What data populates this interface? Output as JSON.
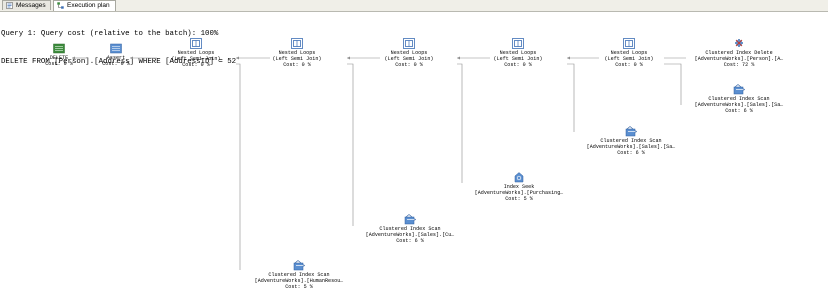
{
  "tabs": [
    {
      "label": "Messages",
      "icon": "messages-icon",
      "active": false
    },
    {
      "label": "Execution plan",
      "icon": "execution-plan-icon",
      "active": true
    }
  ],
  "query": {
    "header": "Query 1: Query cost (relative to the batch): 100%",
    "statement": "DELETE FROM [Person].[Address] WHERE [AddressID] = 52"
  },
  "colors": {
    "icon_blue": "#3d6fb5",
    "icon_green": "#3c8a3c",
    "line": "#8c8c8c"
  },
  "plan": {
    "nodes": [
      {
        "id": "delete",
        "icon": "delete-result-icon",
        "lines": [
          "DELETE",
          "Cost: 0 %"
        ]
      },
      {
        "id": "assert",
        "icon": "assert-icon",
        "lines": [
          "Assert",
          "Cost: 0 %"
        ]
      },
      {
        "id": "nl1",
        "icon": "nested-loops-icon",
        "lines": [
          "Nested Loops",
          "(Left Semi Join)",
          "Cost: 0 %"
        ]
      },
      {
        "id": "nl2",
        "icon": "nested-loops-icon",
        "lines": [
          "Nested Loops",
          "(Left Semi Join)",
          "Cost: 0 %"
        ]
      },
      {
        "id": "nl3",
        "icon": "nested-loops-icon",
        "lines": [
          "Nested Loops",
          "(Left Semi Join)",
          "Cost: 0 %"
        ]
      },
      {
        "id": "nl4",
        "icon": "nested-loops-icon",
        "lines": [
          "Nested Loops",
          "(Left Semi Join)",
          "Cost: 0 %"
        ]
      },
      {
        "id": "nl5",
        "icon": "nested-loops-icon",
        "lines": [
          "Nested Loops",
          "(Left Semi Join)",
          "Cost: 0 %"
        ]
      },
      {
        "id": "cid",
        "icon": "clustered-index-delete-icon",
        "lines": [
          "Clustered Index Delete",
          "[AdventureWorks].[Person].[A…",
          "Cost: 72 %"
        ]
      },
      {
        "id": "cis1",
        "icon": "clustered-index-scan-icon",
        "lines": [
          "Clustered Index Scan",
          "[AdventureWorks].[Sales].[Sa…",
          "Cost: 6 %"
        ]
      },
      {
        "id": "cis2",
        "icon": "clustered-index-scan-icon",
        "lines": [
          "Clustered Index Scan",
          "[AdventureWorks].[Sales].[Sa…",
          "Cost: 6 %"
        ]
      },
      {
        "id": "seek",
        "icon": "index-seek-icon",
        "lines": [
          "Index Seek",
          "[AdventureWorks].[Purchasing…",
          "Cost: 5 %"
        ]
      },
      {
        "id": "cis3",
        "icon": "clustered-index-scan-icon",
        "lines": [
          "Clustered Index Scan",
          "[AdventureWorks].[Sales].[Cu…",
          "Cost: 6 %"
        ]
      },
      {
        "id": "cis4",
        "icon": "clustered-index-scan-icon",
        "lines": [
          "Clustered Index Scan",
          "[AdventureWorks].[HumanResou…",
          "Cost: 5 %"
        ]
      }
    ]
  }
}
